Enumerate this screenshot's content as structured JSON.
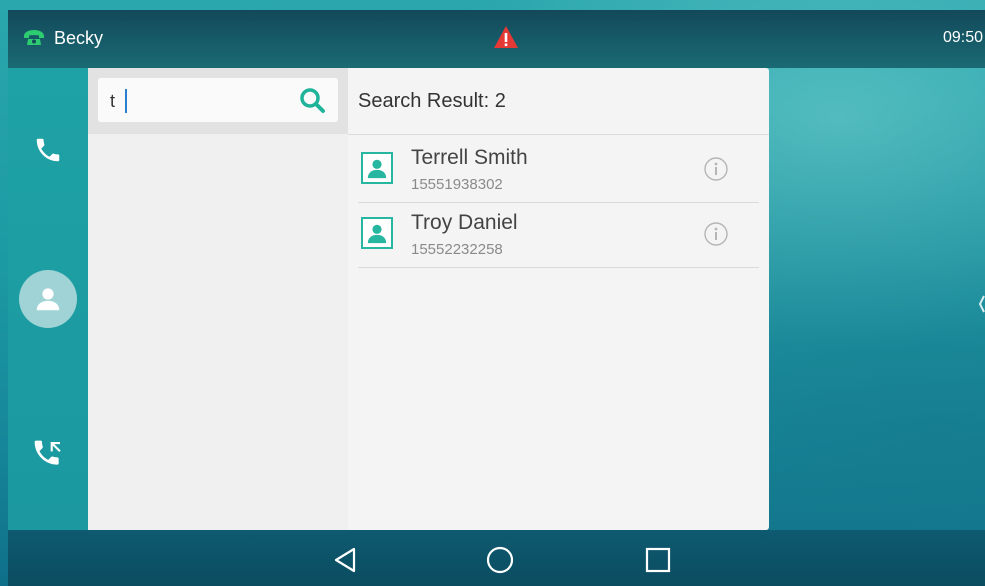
{
  "status_bar": {
    "user_name": "Becky",
    "time": "09:50",
    "icons": [
      "phone-handset-icon",
      "alert-triangle-icon"
    ]
  },
  "left_nav": {
    "items": [
      {
        "icon": "phone-icon",
        "active": false
      },
      {
        "icon": "contacts-icon",
        "active": true
      },
      {
        "icon": "call-history-icon",
        "active": false
      }
    ]
  },
  "search": {
    "value": "t",
    "icon": "search-icon"
  },
  "results": {
    "title": "Search Result: 2",
    "items": [
      {
        "name": "Terrell Smith",
        "number": "15551938302"
      },
      {
        "name": "Troy Daniel",
        "number": "15552232258"
      }
    ]
  },
  "bottom_nav": {
    "buttons": [
      "back-icon",
      "home-icon",
      "recent-apps-icon"
    ]
  },
  "colors": {
    "accent": "#27b6a0",
    "nav_bg": "#1ea2a5",
    "status_bg": "#13495a"
  }
}
